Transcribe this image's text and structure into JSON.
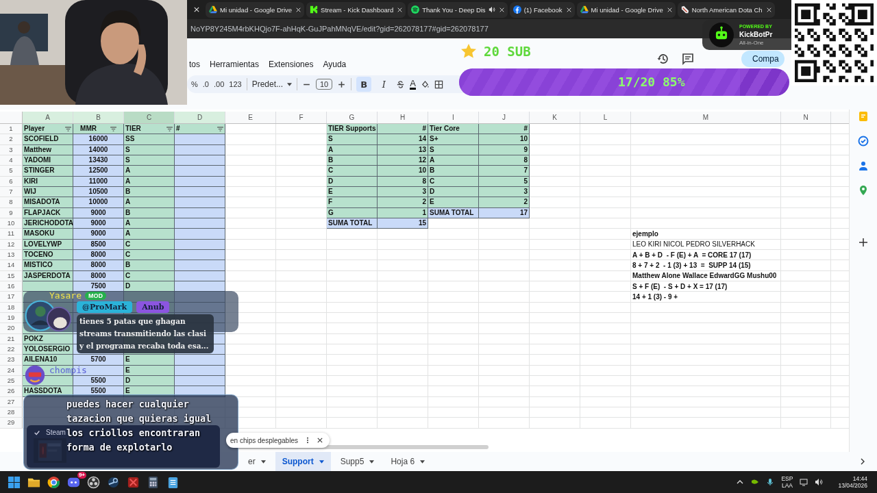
{
  "browser": {
    "tabs": [
      {
        "title": "Mi unidad - Google Drive",
        "kind": "drive",
        "audio": false
      },
      {
        "title": "Stream - Kick Dashboard",
        "kind": "kick",
        "audio": false
      },
      {
        "title": "Thank You - Deep Dis",
        "kind": "spotify",
        "audio": true
      },
      {
        "title": "(1) Facebook",
        "kind": "facebook",
        "audio": false
      },
      {
        "title": "Mi unidad - Google Drive",
        "kind": "drive",
        "audio": false
      },
      {
        "title": "North American Dota Ch",
        "kind": "dota",
        "audio": false
      }
    ],
    "url": "NoYP8Y245M4rbKHQjo7F-ahHqK-GuJPahMNqVE/edit?gid=262078177#gid=262078177"
  },
  "sheets": {
    "menu": [
      "tos",
      "Herramientas",
      "Extensiones",
      "Ayuda"
    ],
    "number_formats": [
      "%",
      ".0",
      ".00",
      "123"
    ],
    "font": "Predet...",
    "font_size": "10",
    "styles": [
      {
        "label": "B",
        "kind": "bold",
        "selected": true
      },
      {
        "label": "I",
        "kind": "italic",
        "selected": false
      }
    ],
    "text_color_label": "A",
    "share_label": "Compa",
    "columns": [
      {
        "label": "A",
        "filtered": true,
        "selected": false
      },
      {
        "label": "B",
        "filtered": true,
        "selected": false
      },
      {
        "label": "C",
        "filtered": true,
        "selected": true
      },
      {
        "label": "D",
        "filtered": true,
        "selected": false
      },
      {
        "label": "E",
        "filtered": false,
        "selected": false
      },
      {
        "label": "F",
        "filtered": false,
        "selected": false
      },
      {
        "label": "G",
        "filtered": false,
        "selected": false
      },
      {
        "label": "H",
        "filtered": false,
        "selected": false
      },
      {
        "label": "I",
        "filtered": false,
        "selected": false
      },
      {
        "label": "J",
        "filtered": false,
        "selected": false
      },
      {
        "label": "K",
        "filtered": false,
        "selected": false
      },
      {
        "label": "L",
        "filtered": false,
        "selected": false
      },
      {
        "label": "M",
        "filtered": false,
        "selected": false
      },
      {
        "label": "N",
        "filtered": false,
        "selected": false
      }
    ],
    "row_numbers": [
      "1",
      "2",
      "3",
      "4",
      "5",
      "6",
      "7",
      "8",
      "9",
      "10",
      "11",
      "12",
      "13",
      "14",
      "15",
      "16",
      "17",
      "18",
      "19",
      "20",
      "21",
      "22",
      "23",
      "24",
      "25",
      "26",
      "27",
      "28",
      "29"
    ],
    "players": {
      "header": [
        "Player",
        "MMR",
        "TIER",
        "#"
      ],
      "rows": [
        {
          "player": "SCOFIELD",
          "mmr": "16000",
          "tier": "SS"
        },
        {
          "player": "Matthew",
          "mmr": "14000",
          "tier": "S"
        },
        {
          "player": "YADOMI",
          "mmr": "13430",
          "tier": "S"
        },
        {
          "player": "STINGER",
          "mmr": "12500",
          "tier": "A"
        },
        {
          "player": "KIRI",
          "mmr": "11000",
          "tier": "A"
        },
        {
          "player": "WIJ",
          "mmr": "10500",
          "tier": "B"
        },
        {
          "player": "MISADOTA",
          "mmr": "10000",
          "tier": "A"
        },
        {
          "player": "FLAPJACK",
          "mmr": "9000",
          "tier": "B"
        },
        {
          "player": "JERICHODOTA",
          "mmr": "9000",
          "tier": "A"
        },
        {
          "player": "MASOKU",
          "mmr": "9000",
          "tier": "A"
        },
        {
          "player": "LOVELYWP",
          "mmr": "8500",
          "tier": "C"
        },
        {
          "player": "TOCENO",
          "mmr": "8000",
          "tier": "C"
        },
        {
          "player": "MISTICO",
          "mmr": "8000",
          "tier": "B"
        },
        {
          "player": "JASPERDOTA",
          "mmr": "8000",
          "tier": "C"
        },
        {
          "mmr": "7500",
          "tier": "D"
        },
        {},
        {},
        {},
        {},
        {
          "player": "POKZ"
        },
        {
          "player": "YOLOSERGIO"
        },
        {
          "player": "AILENA10",
          "mmr": "5700",
          "tier": "E"
        },
        {
          "tier": "E"
        },
        {
          "mmr": "5500",
          "tier": "D"
        },
        {
          "player": "HASSDOTA",
          "mmr": "5500",
          "tier": "E"
        }
      ]
    },
    "supports": {
      "header": [
        "TIER Supports",
        "#"
      ],
      "rows": [
        {
          "tier": "S",
          "count": "14"
        },
        {
          "tier": "A",
          "count": "13"
        },
        {
          "tier": "B",
          "count": "12"
        },
        {
          "tier": "C",
          "count": "10"
        },
        {
          "tier": "D",
          "count": "8"
        },
        {
          "tier": "E",
          "count": "3"
        },
        {
          "tier": "F",
          "count": "2"
        },
        {
          "tier": "G",
          "count": "1"
        }
      ],
      "total": {
        "label": "SUMA TOTAL",
        "count": "15"
      }
    },
    "core": {
      "header": [
        "Tier Core",
        "#"
      ],
      "rows": [
        {
          "tier": "S+",
          "count": "10"
        },
        {
          "tier": "S",
          "count": "9"
        },
        {
          "tier": "A",
          "count": "8"
        },
        {
          "tier": "B",
          "count": "7"
        },
        {
          "tier": "C",
          "count": "5"
        },
        {
          "tier": "D",
          "count": "3"
        },
        {
          "tier": "E",
          "count": "2"
        }
      ],
      "total": {
        "label": "SUMA TOTAL",
        "count": "17"
      }
    },
    "notes": [
      {
        "text": "ejemplo",
        "bold": true
      },
      {
        "text": "LEO KIRI NICOL PEDRO SILVERHACK",
        "bold": false
      },
      {
        "text": "A + B + D  - F (E) + A  = CORE 17 (17)",
        "bold": true
      },
      {
        "text": "8 + 7 + 2  - 1 (3) + 13  =  SUPP 14 (15)",
        "bold": true
      },
      {
        "text": "Matthew Alone Wallace EdwardGG Mushu00",
        "bold": true
      },
      {
        "text": "S + F (E)  - S + D + X = 17 (17)",
        "bold": true
      },
      {
        "text": "14 + 1 (3) - 9 +",
        "bold": true
      }
    ],
    "toast": "en chips desplegables",
    "sheet_tabs": [
      {
        "label": "er",
        "selected": false
      },
      {
        "label": "Support",
        "selected": true
      },
      {
        "label": "Supp5",
        "selected": false
      },
      {
        "label": "Hoja 6",
        "selected": false
      }
    ]
  },
  "stream": {
    "goal": {
      "label": "20 SUB",
      "progress": "17/20 85%",
      "level": 0.85
    },
    "bot": {
      "powered": "POWERED BY",
      "name": "KickBotPr",
      "tagline": "All-in-One"
    },
    "chat": [
      {
        "user": "Yasare",
        "role_badge": "MOD",
        "badges": [
          {
            "text": "@ProMark",
            "color": "#2bb3d9"
          },
          {
            "text": "Anub",
            "color": "#8b55e0"
          }
        ],
        "text": "tienes 5 patas que ghagan streams transmitiendo las clasi y el programa recaba toda esa..."
      },
      {
        "user": "chompis",
        "text": "puedes hacer cualquier tazacion que quieras igual los criollos encontraran forma de explotarlo"
      }
    ],
    "notification": {
      "app": "Steam"
    }
  },
  "taskbar": {
    "chat_badge": "9+",
    "language": "ESP",
    "layout": "LAA",
    "time": "14:44",
    "date": "13/04/2026"
  }
}
